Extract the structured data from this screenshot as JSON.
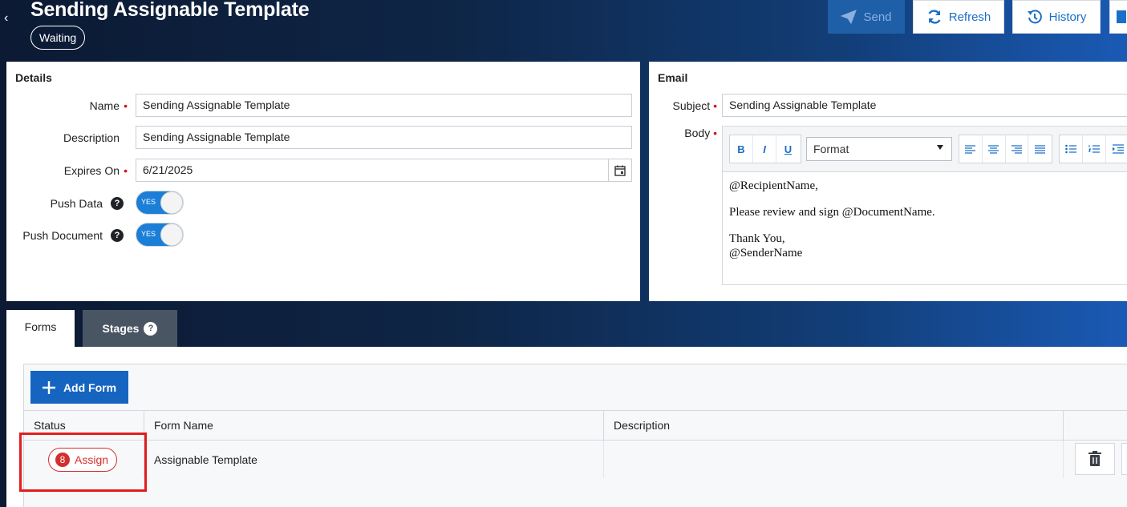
{
  "header": {
    "back_glyph": "‹",
    "title": "Sending Assignable Template",
    "status_badge": "Waiting",
    "actions": [
      {
        "label": "Send",
        "icon": "paper-plane-icon",
        "state": "disabled"
      },
      {
        "label": "Refresh",
        "icon": "refresh-icon"
      },
      {
        "label": "History",
        "icon": "history-icon"
      }
    ]
  },
  "details": {
    "title": "Details",
    "name_label": "Name",
    "name_value": "Sending Assignable Template",
    "description_label": "Description",
    "description_value": "Sending Assignable Template",
    "expires_label": "Expires On",
    "expires_value": "6/21/2025",
    "push_data_label": "Push Data",
    "push_data_value": "YES",
    "push_document_label": "Push Document",
    "push_document_value": "YES",
    "help_glyph": "?"
  },
  "email": {
    "title": "Email",
    "subject_label": "Subject",
    "subject_value": "Sending Assignable Template",
    "body_label": "Body",
    "toolbar": {
      "bold": "B",
      "italic": "I",
      "underline": "U",
      "format_value": "Format"
    },
    "body_lines": {
      "greeting": "@RecipientName,",
      "request": "Please review and sign @DocumentName.",
      "thanks": "Thank You,",
      "sender": "@SenderName"
    }
  },
  "tabs": {
    "forms": "Forms",
    "stages": "Stages",
    "help_glyph": "?"
  },
  "forms_grid": {
    "add_button": "Add Form",
    "columns": {
      "status": "Status",
      "form_name": "Form Name",
      "description": "Description"
    },
    "rows": [
      {
        "status_count": "8",
        "status_label": "Assign",
        "form_name": "Assignable Template",
        "description": ""
      }
    ]
  },
  "colors": {
    "primary": "#1565c0",
    "accent_blue": "#1b6fc6",
    "required": "#dd1111",
    "status_red": "#d32f2f",
    "highlight": "#e01e1e"
  }
}
